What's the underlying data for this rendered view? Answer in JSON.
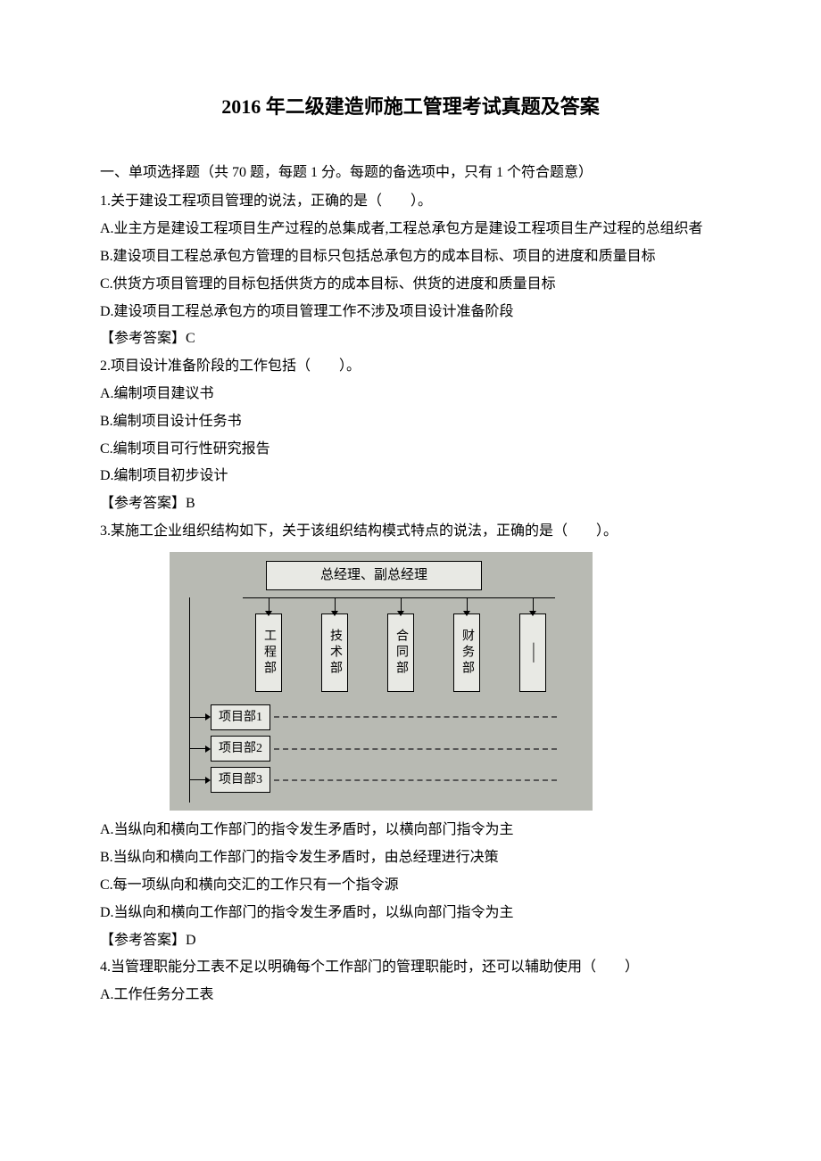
{
  "title": "2016 年二级建造师施工管理考试真题及答案",
  "section1": {
    "header": "一、单项选择题（共 70 题，每题 1 分。每题的备选项中，只有 1 个符合题意）",
    "q1": {
      "stem": "1.关于建设工程项目管理的说法，正确的是（　　）。",
      "a": "A.业主方是建设工程项目生产过程的总集成者,工程总承包方是建设工程项目生产过程的总组织者",
      "b": "B.建设项目工程总承包方管理的目标只包括总承包方的成本目标、项目的进度和质量目标",
      "c": "C.供货方项目管理的目标包括供货方的成本目标、供货的进度和质量目标",
      "d": "D.建设项目工程总承包方的项目管理工作不涉及项目设计准备阶段",
      "ans": "【参考答案】C"
    },
    "q2": {
      "stem": "2.项目设计准备阶段的工作包括（　　）。",
      "a": "A.编制项目建议书",
      "b": "B.编制项目设计任务书",
      "c": "C.编制项目可行性研究报告",
      "d": "D.编制项目初步设计",
      "ans": "【参考答案】B"
    },
    "q3": {
      "stem": "3.某施工企业组织结构如下，关于该组织结构模式特点的说法，正确的是（　　）。",
      "a": "A.当纵向和横向工作部门的指令发生矛盾时，以横向部门指令为主",
      "b": "B.当纵向和横向工作部门的指令发生矛盾时，由总经理进行决策",
      "c": "C.每一项纵向和横向交汇的工作只有一个指令源",
      "d": "D.当纵向和横向工作部门的指令发生矛盾时，以纵向部门指令为主",
      "ans": "【参考答案】D"
    },
    "q4": {
      "stem": "4.当管理职能分工表不足以明确每个工作部门的管理职能时，还可以辅助使用（　　）",
      "a": "A.工作任务分工表"
    }
  },
  "diagram": {
    "top": "总经理、副总经理",
    "depts": [
      "工程部",
      "技术部",
      "合同部",
      "财务部",
      "⸺"
    ],
    "projects": [
      "项目部1",
      "项目部2",
      "项目部3"
    ]
  }
}
